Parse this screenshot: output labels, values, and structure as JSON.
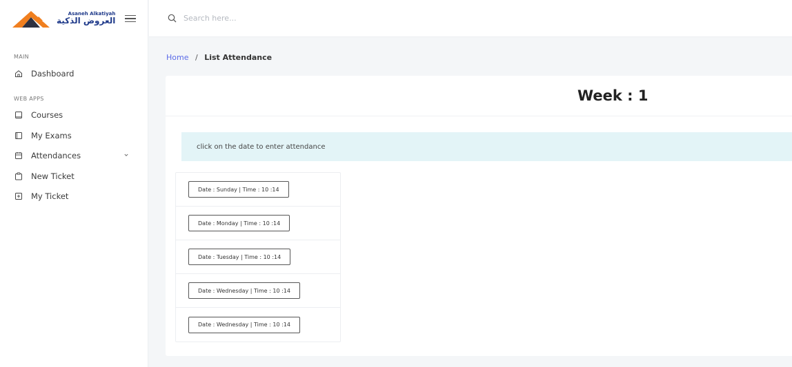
{
  "brand": {
    "name_en": "Asaneh Alkatiyah",
    "name_ar": "العروض الذكية"
  },
  "search": {
    "placeholder": "Search here..."
  },
  "sidebar": {
    "sections": [
      {
        "heading": "MAIN"
      },
      {
        "heading": "WEB APPS"
      }
    ],
    "items": [
      {
        "label": "Dashboard",
        "icon": "home-icon"
      },
      {
        "label": "Courses",
        "icon": "tablet-icon"
      },
      {
        "label": "My Exams",
        "icon": "book-icon"
      },
      {
        "label": "Attendances",
        "icon": "calendar-icon",
        "has_submenu": true
      },
      {
        "label": "New Ticket",
        "icon": "clipboard-icon"
      },
      {
        "label": "My Ticket",
        "icon": "plus-square-icon"
      }
    ]
  },
  "breadcrumb": {
    "home": "Home",
    "separator": "/",
    "current": "List Attendance"
  },
  "main": {
    "week_title": "Week : 1",
    "alert": "click on the date to enter attendance",
    "dates": [
      {
        "label": "Date : Sunday | Time : 10 :14"
      },
      {
        "label": "Date : Monday | Time : 10 :14"
      },
      {
        "label": "Date : Tuesday | Time : 10 :14"
      },
      {
        "label": "Date : Wednesday | Time : 10 :14"
      },
      {
        "label": "Date : Wednesday | Time : 10 :14"
      }
    ]
  },
  "colors": {
    "accent": "#5b6be8",
    "alert_bg": "#e3f4f7",
    "logo_orange": "#f07f1f",
    "logo_dark": "#2e3140",
    "brand_text": "#1f3a8a",
    "page_bg": "#f4f6f8"
  }
}
